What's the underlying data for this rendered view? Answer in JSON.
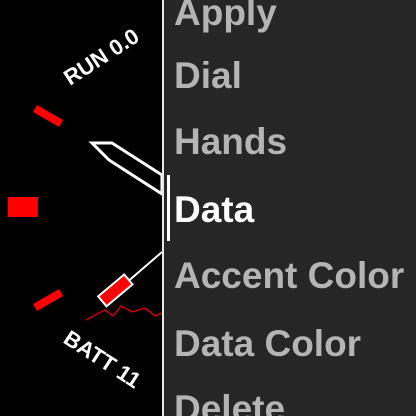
{
  "watch_preview": {
    "top_complication": "RUN 0.0",
    "bottom_complication": "BATT 11",
    "accent_color": "#ff0000",
    "hand_color": "#ffffff"
  },
  "menu": {
    "items": [
      {
        "label": "Apply",
        "selected": false
      },
      {
        "label": "Dial",
        "selected": false
      },
      {
        "label": "Hands",
        "selected": false
      },
      {
        "label": "Data",
        "selected": true
      },
      {
        "label": "Accent Color",
        "selected": false
      },
      {
        "label": "Data Color",
        "selected": false
      },
      {
        "label": "Delete",
        "selected": false
      }
    ]
  }
}
